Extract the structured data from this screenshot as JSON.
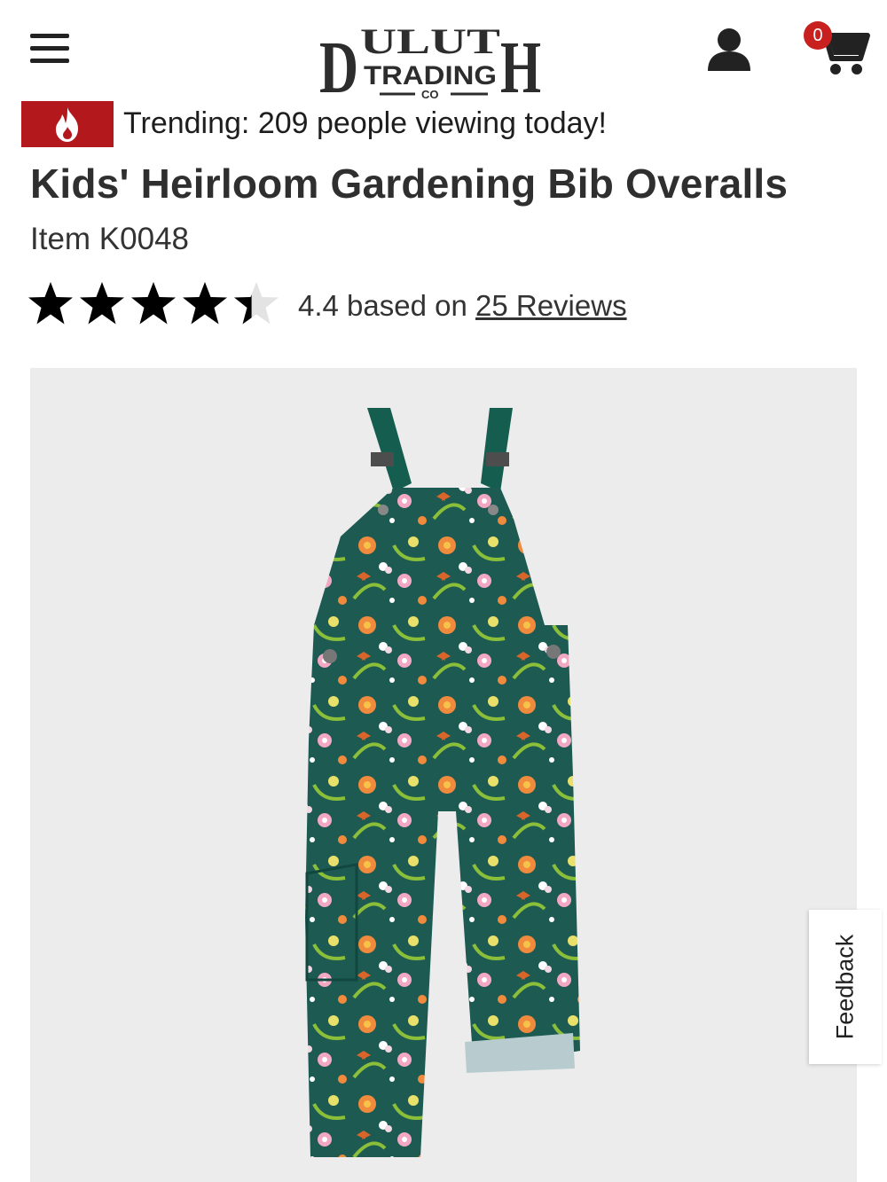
{
  "header": {
    "menu_icon": "hamburger-icon",
    "logo_lines": [
      "DULUTH",
      "TRADING",
      "CO"
    ],
    "account_icon": "user-icon",
    "cart_icon": "cart-icon",
    "cart_count": "0",
    "colors": {
      "badge": "#c8201f",
      "logo": "#2d2d2d"
    }
  },
  "trending": {
    "icon": "flame-icon",
    "text": "Trending: 209 people viewing today!",
    "colors": {
      "badge_bg": "#b3191c"
    }
  },
  "product": {
    "title": "Kids' Heirloom Gardening Bib Overalls",
    "item_number": "Item K0048",
    "rating": {
      "value": 4.4,
      "max": 5,
      "text_prefix": "4.4 based on ",
      "reviews_link": "25 Reviews"
    },
    "image": {
      "description_icon": "product-photo",
      "colors": {
        "background": "#ececec",
        "fabric": "#1c5a52",
        "straps": "#155e4f"
      }
    }
  },
  "feedback": {
    "label": "Feedback"
  }
}
